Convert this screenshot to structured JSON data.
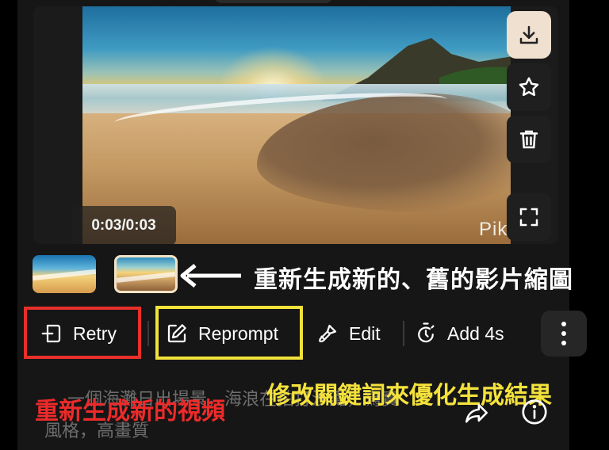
{
  "video": {
    "timestamp": "0:03/0:03",
    "watermark": "Pika"
  },
  "side_actions": [
    {
      "name": "download",
      "icon": "download-icon"
    },
    {
      "name": "favorite",
      "icon": "star-icon"
    },
    {
      "name": "delete",
      "icon": "trash-icon"
    },
    {
      "name": "fullscreen",
      "icon": "fullscreen-icon"
    }
  ],
  "annotations": {
    "thumbnails": "重新生成新的、舊的影片縮圖",
    "retry": "重新生成新的視頻",
    "reprompt": "修改關鍵詞來優化生成結果"
  },
  "actions": {
    "retry_label": "Retry",
    "reprompt_label": "Reprompt",
    "edit_label": "Edit",
    "add_label": "Add 4s"
  },
  "prompt": {
    "line1": "一個海灘日出場景，海浪在拍打沙灘，寫實",
    "line2": "風格，高畫質"
  },
  "colors": {
    "background": "#000000",
    "card": "#161616",
    "highlight_red": "#e8302a",
    "highlight_yellow": "#f2e23a",
    "download_button": "#efe0cf"
  }
}
